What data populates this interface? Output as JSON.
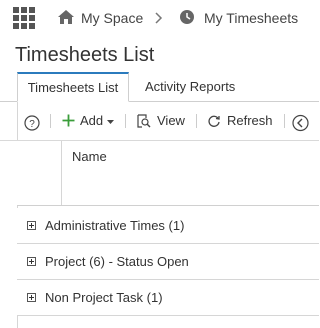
{
  "breadcrumb": {
    "items": [
      {
        "label": "My Space",
        "icon": "home-icon"
      },
      {
        "label": "My Timesheets",
        "icon": "clock-icon"
      }
    ],
    "separator_icon": "chevron-right-icon"
  },
  "page": {
    "title": "Timesheets List"
  },
  "tabs": [
    {
      "label": "Timesheets List",
      "active": true
    },
    {
      "label": "Activity Reports",
      "active": false
    }
  ],
  "toolbar": {
    "help_icon": "help-icon",
    "add_label": "Add",
    "view_label": "View",
    "refresh_label": "Refresh",
    "back_icon": "circle-chevron-left-icon"
  },
  "grid": {
    "columns": [
      "Name"
    ],
    "groups": [
      {
        "label": "Administrative Times (1)"
      },
      {
        "label": "Project (6) - Status Open"
      },
      {
        "label": "Non Project Task (1)"
      }
    ]
  },
  "colors": {
    "accent": "#2b7bbd",
    "add_green": "#3a9d3a"
  }
}
